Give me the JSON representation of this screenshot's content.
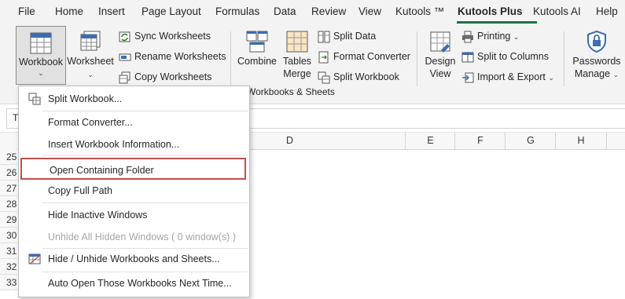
{
  "menubar": {
    "tabs": [
      {
        "label": "File"
      },
      {
        "label": "Home"
      },
      {
        "label": "Insert"
      },
      {
        "label": "Page Layout"
      },
      {
        "label": "Formulas"
      },
      {
        "label": "Data"
      },
      {
        "label": "Review"
      },
      {
        "label": "View"
      },
      {
        "label": "Kutools ™"
      },
      {
        "label": "Kutools Plus"
      },
      {
        "label": "Kutools AI"
      },
      {
        "label": "Help"
      }
    ],
    "active_tab": "Kutools Plus",
    "accent_color": "#1e7145"
  },
  "ribbon": {
    "workbook_label": "Workbook",
    "worksheet_label": "Worksheet",
    "sync_worksheets": "Sync Worksheets",
    "rename_worksheets": "Rename Worksheets",
    "copy_worksheets": "Copy Worksheets",
    "combine": "Combine",
    "tables_merge_line1": "Tables",
    "tables_merge_line2": "Merge",
    "split_data": "Split Data",
    "format_converter": "Format Converter",
    "split_workbook": "Split Workbook",
    "design_view_line1": "Design",
    "design_view_line2": "View",
    "printing": "Printing",
    "split_to_columns": "Split to Columns",
    "import_export": "Import & Export",
    "passwords_line1": "Passwords",
    "passwords_line2": "Manage",
    "group_label": "Workbooks & Sheets",
    "chevron": "⌄"
  },
  "formula_bar": {
    "name_box_fragment": "T"
  },
  "columns": [
    "D",
    "E",
    "F",
    "G",
    "H"
  ],
  "rows": [
    "25",
    "26",
    "27",
    "28",
    "29",
    "30",
    "31",
    "32",
    "33"
  ],
  "dropdown": {
    "items": [
      {
        "label": "Split Workbook...",
        "icon": "split-workbook-icon",
        "disabled": false
      },
      {
        "label": "Format Converter...",
        "icon": "",
        "disabled": false
      },
      {
        "label": "Insert Workbook Information...",
        "icon": "",
        "disabled": false
      },
      {
        "label": "Open Containing Folder",
        "icon": "",
        "disabled": false,
        "highlighted": true
      },
      {
        "label": "Copy Full Path",
        "icon": "",
        "disabled": false
      },
      {
        "label": "Hide Inactive Windows",
        "icon": "",
        "disabled": false
      },
      {
        "label": "Unhide All Hidden Windows ( 0 window(s) )",
        "icon": "",
        "disabled": true
      },
      {
        "label": "Hide / Unhide Workbooks and Sheets...",
        "icon": "hide-unhide-icon",
        "disabled": false
      },
      {
        "label": "Auto Open Those Workbooks Next Time...",
        "icon": "",
        "disabled": false
      }
    ],
    "highlight_color": "#c0504d"
  }
}
